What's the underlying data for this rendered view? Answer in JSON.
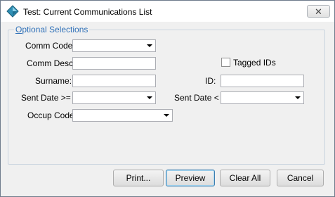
{
  "window": {
    "title": "Test: Current Communications List",
    "close_glyph": "✕",
    "icon": "app-diamond-icon"
  },
  "group": {
    "legend_first": "O",
    "legend_rest": "ptional Selections"
  },
  "form": {
    "comm_code_label": "Comm Code:",
    "comm_code_value": "",
    "comm_desc_label": "Comm Desc:",
    "comm_desc_value": "",
    "surname_label": "Surname:",
    "surname_value": "",
    "sent_date_gte_label": "Sent Date >=",
    "sent_date_gte_value": "",
    "occup_code_label": "Occup Code",
    "occup_code_value": "",
    "tagged_ids_label": "Tagged IDs",
    "tagged_ids_checked": false,
    "id_label": "ID:",
    "id_value": "",
    "sent_date_lt_label": "Sent Date <",
    "sent_date_lt_value": ""
  },
  "buttons": {
    "print": "Print...",
    "preview": "Preview",
    "clear_all": "Clear All",
    "cancel": "Cancel"
  }
}
